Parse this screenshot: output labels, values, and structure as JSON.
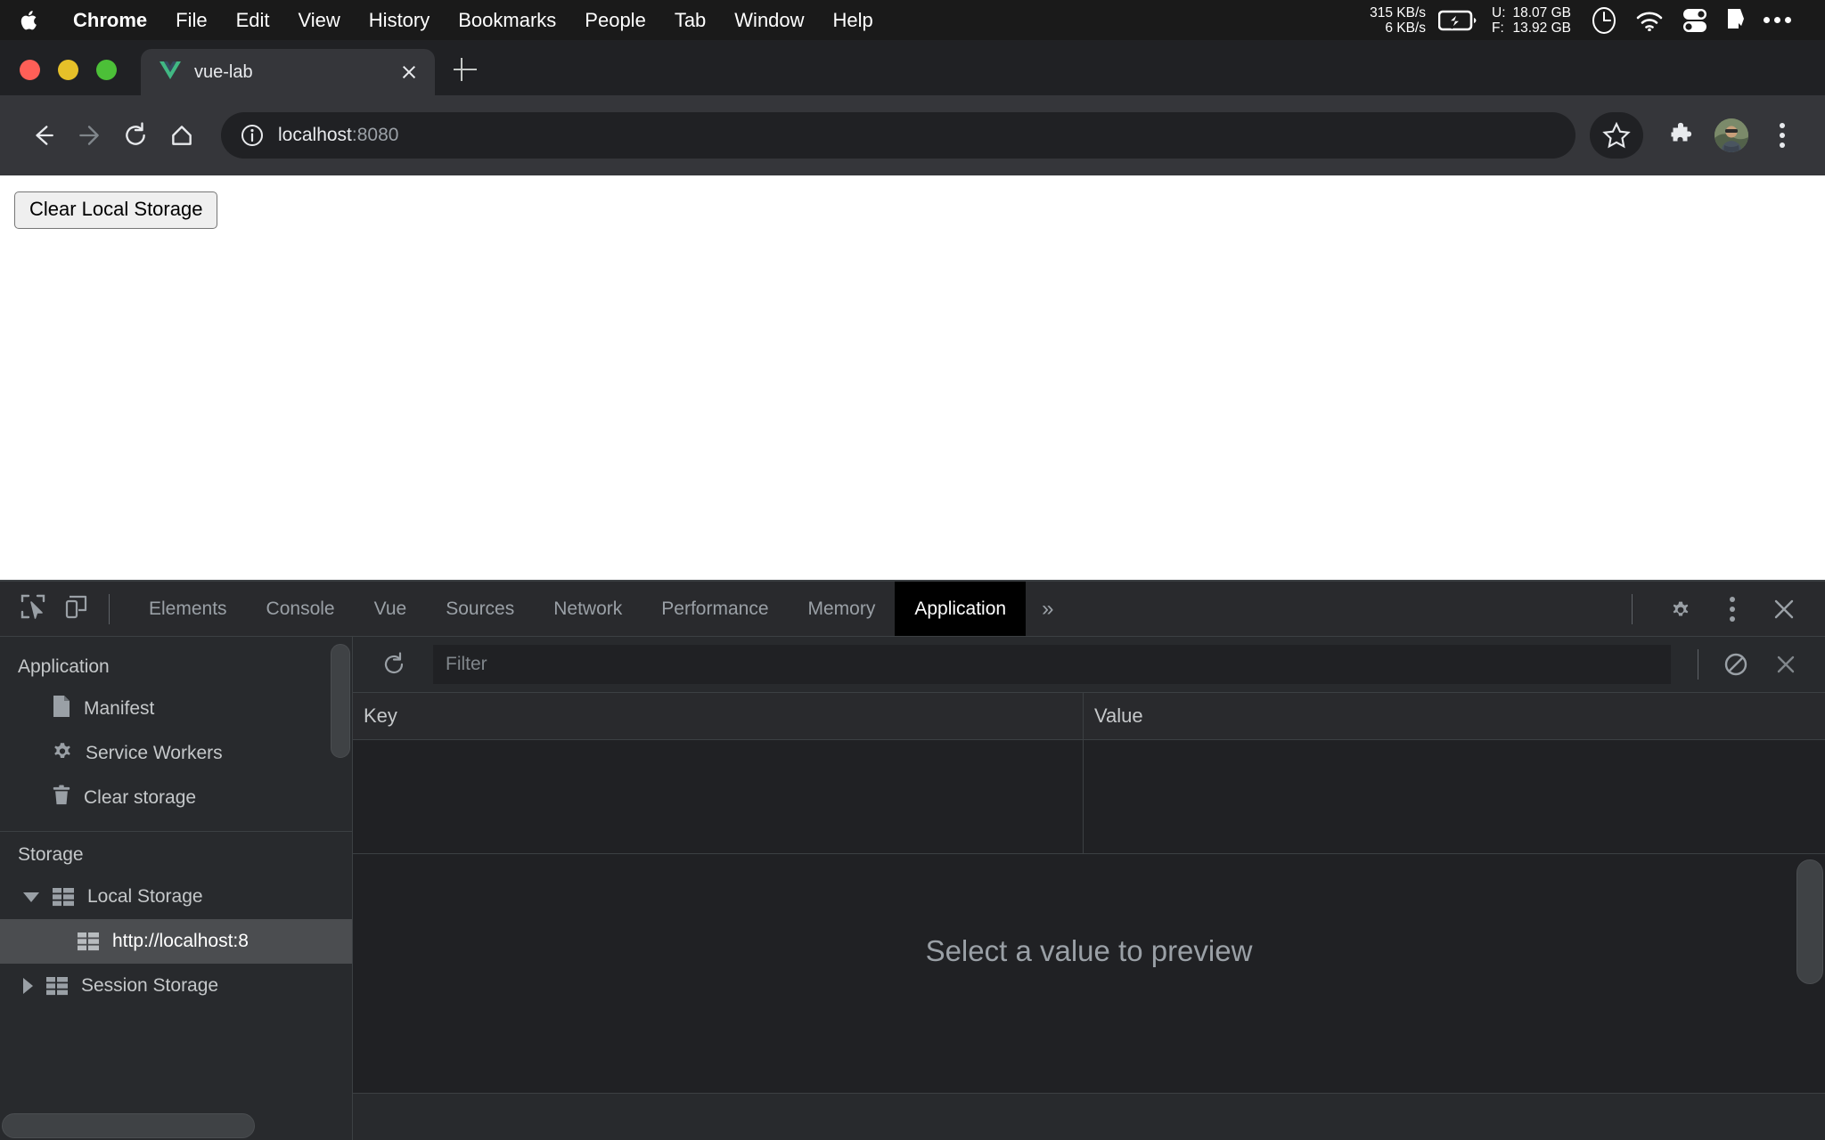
{
  "menubar": {
    "apple_icon": "apple-logo",
    "items": [
      {
        "label": "Chrome",
        "bold": true
      },
      {
        "label": "File",
        "bold": false
      },
      {
        "label": "Edit",
        "bold": false
      },
      {
        "label": "View",
        "bold": false
      },
      {
        "label": "History",
        "bold": false
      },
      {
        "label": "Bookmarks",
        "bold": false
      },
      {
        "label": "People",
        "bold": false
      },
      {
        "label": "Tab",
        "bold": false
      },
      {
        "label": "Window",
        "bold": false
      },
      {
        "label": "Help",
        "bold": false
      }
    ],
    "status": {
      "net_down": "315 KB/s",
      "net_up": "6 KB/s",
      "battery_icon": "battery-charging-icon",
      "mem_used_label": "U:",
      "mem_free_label": "F:",
      "mem_used_value": "18.07 GB",
      "mem_free_value": "13.92 GB",
      "clock_icon": "clock-icon",
      "wifi_icon": "wifi-icon",
      "toggles_icon": "control-center-icon",
      "flag_icon": "flag-icon",
      "overflow_icon": "ellipsis-icon"
    }
  },
  "browser": {
    "traffic_lights": {
      "close_color": "#ff5f57",
      "minimize_color": "#e6c029",
      "maximize_color": "#4cc038"
    },
    "tab": {
      "favicon": "vue-logo-icon",
      "title": "vue-lab",
      "close_icon": "close-icon"
    },
    "new_tab_icon": "plus-icon",
    "toolbar": {
      "back_icon": "arrow-back-icon",
      "forward_icon": "arrow-forward-icon",
      "reload_icon": "reload-icon",
      "home_icon": "home-icon",
      "info_icon": "info-circle-icon",
      "url_host": "localhost",
      "url_port": ":8080",
      "bookmark_icon": "star-icon",
      "extensions_icon": "puzzle-piece-icon",
      "profile_icon": "avatar",
      "menu_icon": "kebab-menu-icon"
    }
  },
  "page": {
    "clear_button_label": "Clear Local Storage"
  },
  "devtools": {
    "inspect_icon": "inspect-element-icon",
    "device_icon": "device-toolbar-icon",
    "tabs": [
      {
        "label": "Elements",
        "active": false
      },
      {
        "label": "Console",
        "active": false
      },
      {
        "label": "Vue",
        "active": false
      },
      {
        "label": "Sources",
        "active": false
      },
      {
        "label": "Network",
        "active": false
      },
      {
        "label": "Performance",
        "active": false
      },
      {
        "label": "Memory",
        "active": false
      },
      {
        "label": "Application",
        "active": true
      }
    ],
    "more_tabs_icon": "chevron-double-right-icon",
    "settings_icon": "gear-icon",
    "more_options_icon": "kebab-menu-icon",
    "close_icon": "close-icon",
    "sidebar": {
      "sections": [
        {
          "title": "Application",
          "items": [
            {
              "label": "Manifest",
              "icon": "document-icon",
              "selected": false
            },
            {
              "label": "Service Workers",
              "icon": "gear-icon",
              "selected": false
            },
            {
              "label": "Clear storage",
              "icon": "trash-icon",
              "selected": false
            }
          ]
        },
        {
          "title": "Storage",
          "items": [
            {
              "label": "Local Storage",
              "icon": "database-icon",
              "selected": false,
              "arrow": "down",
              "level": 2
            },
            {
              "label": "http://localhost:8",
              "icon": "database-icon",
              "selected": true,
              "arrow": "none",
              "level": 3
            },
            {
              "label": "Session Storage",
              "icon": "database-icon",
              "selected": false,
              "arrow": "right",
              "level": 2
            }
          ]
        }
      ]
    },
    "storage_panel": {
      "refresh_icon": "refresh-icon",
      "filter_placeholder": "Filter",
      "filter_value": "",
      "clear_all_icon": "clear-all-icon",
      "delete_selected_icon": "close-icon",
      "columns": [
        "Key",
        "Value"
      ],
      "rows": [],
      "preview_placeholder": "Select a value to preview"
    }
  }
}
